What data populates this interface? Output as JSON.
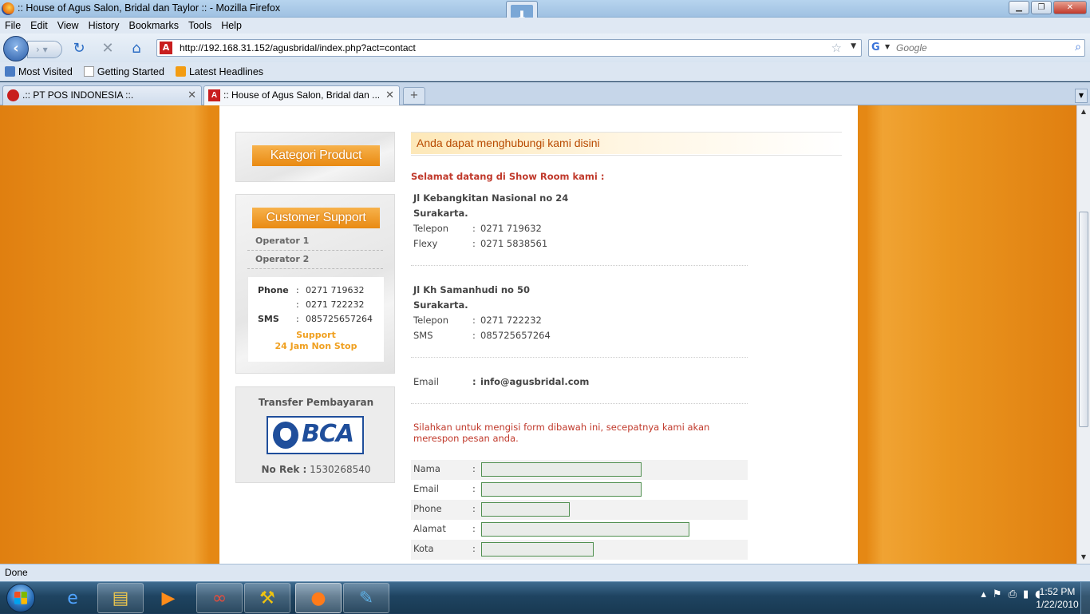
{
  "window": {
    "title": ":: House of Agus Salon, Bridal dan Taylor :: - Mozilla Firefox"
  },
  "menu": [
    "File",
    "Edit",
    "View",
    "History",
    "Bookmarks",
    "Tools",
    "Help"
  ],
  "nav": {
    "url": "http://192.168.31.152/agusbridal/index.php?act=contact",
    "search_placeholder": "Google"
  },
  "bookmarks": [
    "Most Visited",
    "Getting Started",
    "Latest Headlines"
  ],
  "tabs": [
    {
      "label": ".:: PT POS INDONESIA ::."
    },
    {
      "label": ":: House of Agus Salon, Bridal dan ..."
    }
  ],
  "sidebar": {
    "kategori_label": "Kategori Product",
    "support_label": "Customer Support",
    "operators": [
      "Operator 1",
      "Operator 2"
    ],
    "support": {
      "phone_label": "Phone",
      "phone1": "0271 719632",
      "phone2": "0271 722232",
      "sms_label": "SMS",
      "sms": "085725657264",
      "colon": ":",
      "line1": "Support",
      "line2": "24 Jam Non Stop"
    },
    "transfer": {
      "title": "Transfer Pembayaran",
      "bank": "BCA",
      "norek_label": "No Rek :",
      "norek": "1530268540"
    }
  },
  "main": {
    "heading": "Anda dapat menghubungi kami disini",
    "welcome": "Selamat datang di Show Room kami :",
    "colon": ":",
    "address1": {
      "street": "Jl Kebangkitan Nasional no 24",
      "city": "Surakarta.",
      "rows": [
        {
          "label": "Telepon",
          "value": "0271 719632"
        },
        {
          "label": "Flexy",
          "value": "0271 5838561"
        }
      ]
    },
    "address2": {
      "street": "Jl Kh Samanhudi no 50",
      "city": "Surakarta.",
      "rows": [
        {
          "label": "Telepon",
          "value": "0271 722232"
        },
        {
          "label": "SMS",
          "value": "085725657264"
        }
      ]
    },
    "email": {
      "label": "Email",
      "value": "info@agusbridal.com"
    },
    "form_intro": "Silahkan untuk mengisi form dibawah ini, secepatnya kami akan merespon pesan anda.",
    "form": [
      {
        "label": "Nama",
        "value": ""
      },
      {
        "label": "Email",
        "value": ""
      },
      {
        "label": "Phone",
        "value": ""
      },
      {
        "label": "Alamat",
        "value": ""
      },
      {
        "label": "Kota",
        "value": ""
      }
    ]
  },
  "status": "Done",
  "taskbar": {
    "time": "1:52 PM",
    "date": "1/22/2010"
  },
  "colors": {
    "accent": "#e58814",
    "heading": "#b84a00",
    "welcome": "#c0392b",
    "bca": "#1f4e9b"
  }
}
